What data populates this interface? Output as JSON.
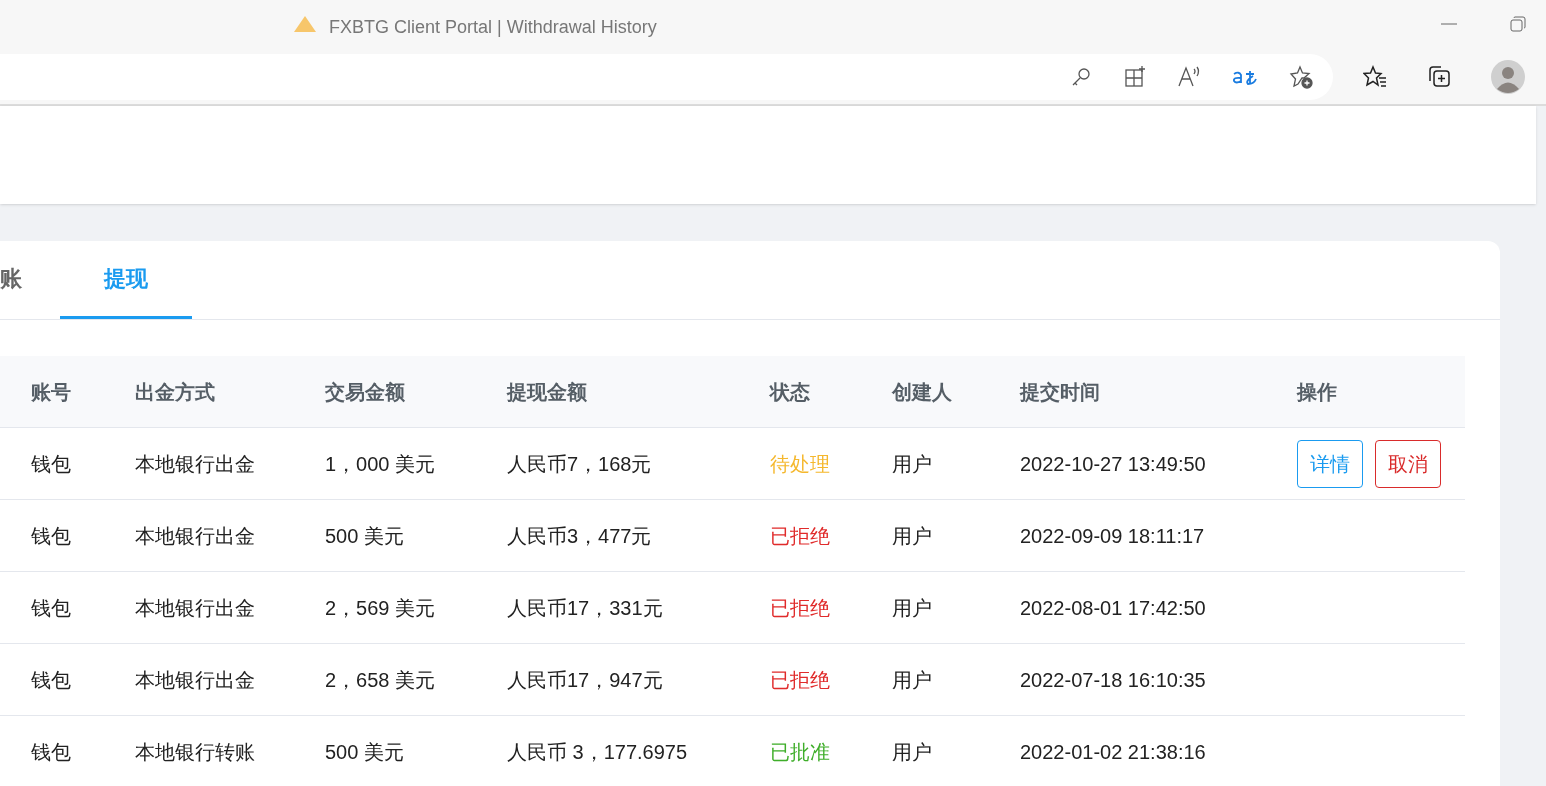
{
  "window": {
    "title": "FXBTG Client Portal | Withdrawal History"
  },
  "tabs": [
    {
      "label": "账",
      "selected": false
    },
    {
      "label": "提现",
      "selected": true
    }
  ],
  "table": {
    "columns": [
      "账号",
      "出金方式",
      "交易金额",
      "提现金额",
      "状态",
      "创建人",
      "提交时间",
      "操作"
    ],
    "rows": [
      {
        "account": "钱包",
        "method": "本地银行出金",
        "amount": "1，000 美元",
        "withdrawal": "人民币7，168元",
        "status": "待处理",
        "color": "#f5b82e",
        "creator": "用户",
        "time": "2022-10-27 13:49:50",
        "actions": [
          {
            "label": "详情",
            "kind": "primary"
          },
          {
            "label": "取消",
            "kind": "danger"
          }
        ]
      },
      {
        "account": "钱包",
        "method": "本地银行出金",
        "amount": "500 美元",
        "withdrawal": "人民币3，477元",
        "status": "已拒绝",
        "color": "#e02b2b",
        "creator": "用户",
        "time": "2022-09-09 18:11:17",
        "actions": []
      },
      {
        "account": "钱包",
        "method": "本地银行出金",
        "amount": "2，569 美元",
        "withdrawal": "人民币17，331元",
        "status": "已拒绝",
        "color": "#e02b2b",
        "creator": "用户",
        "time": "2022-08-01 17:42:50",
        "actions": []
      },
      {
        "account": "钱包",
        "method": "本地银行出金",
        "amount": "2，658 美元",
        "withdrawal": "人民币17，947元",
        "status": "已拒绝",
        "color": "#e02b2b",
        "creator": "用户",
        "time": "2022-07-18 16:10:35",
        "actions": []
      },
      {
        "account": "钱包",
        "method": "本地银行转账",
        "amount": "500 美元",
        "withdrawal": "人民币 3，177.6975",
        "status": "已批准",
        "color": "#3fae2a",
        "creator": "用户",
        "time": "2022-01-02 21:38:16",
        "actions": []
      }
    ]
  }
}
